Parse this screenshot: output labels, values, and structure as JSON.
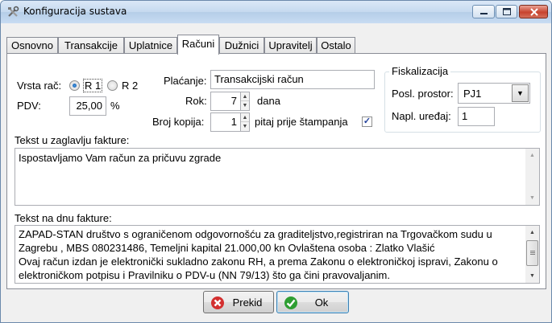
{
  "window": {
    "title": "Konfiguracija sustava"
  },
  "tabs": [
    {
      "label": "Osnovno"
    },
    {
      "label": "Transakcije"
    },
    {
      "label": "Uplatnice"
    },
    {
      "label": "Računi"
    },
    {
      "label": "Dužnici"
    },
    {
      "label": "Upravitelj"
    },
    {
      "label": "Ostalo"
    }
  ],
  "active_tab": "Računi",
  "form": {
    "vrsta_label": "Vrsta rač:",
    "radio_r1_label": "R 1",
    "radio_r2_label": "R 2",
    "selected_vrsta": "R 1",
    "pdv_label": "PDV:",
    "pdv_value": "25,00",
    "pdv_unit": "%",
    "placanje_label": "Plaćanje:",
    "placanje_value": "Transakcijski račun",
    "rok_label": "Rok:",
    "rok_value": "7",
    "rok_unit": "dana",
    "broj_kopija_label": "Broj kopija:",
    "broj_kopija_value": "1",
    "pitaj_label": "pitaj prije štampanja",
    "pitaj_checked": true
  },
  "fiskalizacija": {
    "title": "Fiskalizacija",
    "posl_prostor_label": "Posl. prostor:",
    "posl_prostor_value": "PJ1",
    "napl_uredaj_label": "Napl. uređaj:",
    "napl_uredaj_value": "1"
  },
  "header_text": {
    "label": "Tekst u zaglavlju fakture:",
    "value": "Ispostavljamo Vam račun za pričuvu zgrade"
  },
  "footer_text": {
    "label": "Tekst na dnu fakture:",
    "lines": [
      "ZAPAD-STAN društvo s ograničenom odgovornošću za graditeljstvo,registriran na Trgovačkom sudu u",
      "Zagrebu , MBS 080231486, Temeljni kapital 21.000,00 kn Ovlaštena osoba : Zlatko Vlašić",
      "Ovaj račun izdan je elektronički sukladno zakonu RH, a prema Zakonu o elektroničkoj ispravi, Zakonu o",
      "elektroničkom potpisu i Pravilniku o PDV-u (NN 79/13) što ga čini pravovaljanim."
    ]
  },
  "buttons": {
    "cancel_label": "Prekid",
    "ok_label": "Ok"
  },
  "colors": {
    "accent": "#0b4fa3",
    "cancel_icon": "#d32f2f",
    "ok_icon": "#2e9e32"
  }
}
